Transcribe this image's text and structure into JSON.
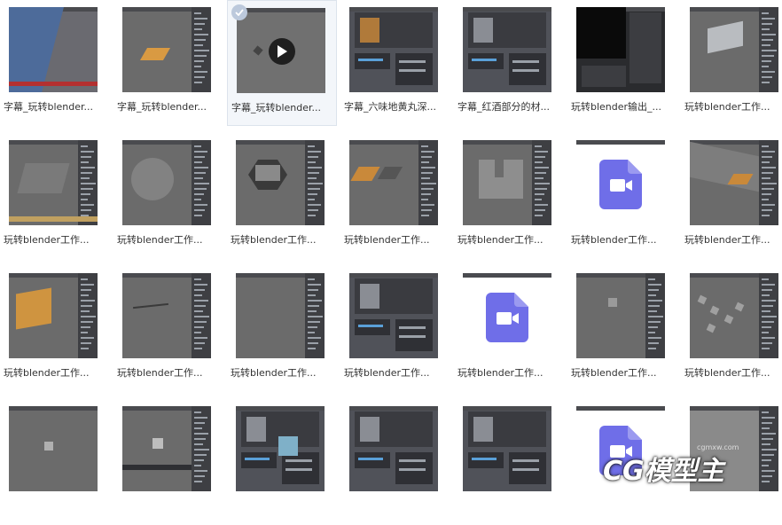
{
  "files": [
    {
      "label": "字幕_玩转blender...",
      "kind": "viewport-blue"
    },
    {
      "label": "字幕_玩转blender...",
      "kind": "viewport-orange"
    },
    {
      "label": "字幕_玩转blender...",
      "kind": "video-selected",
      "selected": true
    },
    {
      "label": "字幕_六味地黄丸深...",
      "kind": "dark-ui"
    },
    {
      "label": "字幕_红酒部分的材...",
      "kind": "dark-ui2"
    },
    {
      "label": "玩转blender输出_...",
      "kind": "black-ui"
    },
    {
      "label": "玩转blender工作...",
      "kind": "viewport-cube"
    },
    {
      "label": "玩转blender工作...",
      "kind": "viewport-box"
    },
    {
      "label": "玩转blender工作...",
      "kind": "viewport-sphere"
    },
    {
      "label": "玩转blender工作...",
      "kind": "viewport-hex"
    },
    {
      "label": "玩转blender工作...",
      "kind": "viewport-hex2"
    },
    {
      "label": "玩转blender工作...",
      "kind": "viewport-block"
    },
    {
      "label": "玩转blender工作...",
      "kind": "video-doc"
    },
    {
      "label": "玩转blender工作...",
      "kind": "viewport-room"
    },
    {
      "label": "玩转blender工作...",
      "kind": "viewport-orange-cube"
    },
    {
      "label": "玩转blender工作...",
      "kind": "viewport-line"
    },
    {
      "label": "玩转blender工作...",
      "kind": "viewport-empty"
    },
    {
      "label": "玩转blender工作...",
      "kind": "dark-ui3"
    },
    {
      "label": "玩转blender工作...",
      "kind": "video-doc"
    },
    {
      "label": "玩转blender工作...",
      "kind": "viewport-small-cube"
    },
    {
      "label": "玩转blender工作...",
      "kind": "viewport-scatter"
    },
    {
      "label": "",
      "kind": "viewport-small-cube2"
    },
    {
      "label": "",
      "kind": "viewport-small-cube3"
    },
    {
      "label": "",
      "kind": "dark-ui4"
    },
    {
      "label": "",
      "kind": "dark-ui5"
    },
    {
      "label": "",
      "kind": "dark-ui6"
    },
    {
      "label": "",
      "kind": "video-doc"
    },
    {
      "label": "",
      "kind": "viewport-gray"
    }
  ],
  "watermark": {
    "logo_text": "CG模型主",
    "sub_text": "cgmxw.com"
  },
  "colors": {
    "doc_icon": "#6f6ee8",
    "selected_bg": "#f3f6fa",
    "check": "#bcc9dc"
  },
  "icons": {
    "selected": "check-icon",
    "video": "play-icon",
    "doc": "video-file-icon"
  }
}
